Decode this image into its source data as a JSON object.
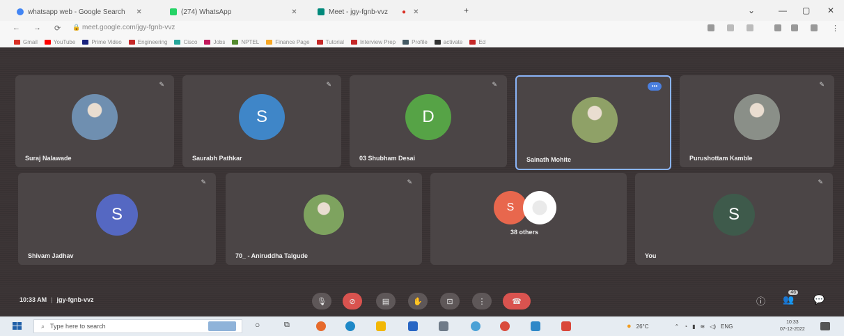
{
  "browser": {
    "tabs": [
      {
        "label": "whatsapp web - Google Search",
        "color": "#4285f4"
      },
      {
        "label": "(274) WhatsApp",
        "color": "#25d366"
      },
      {
        "label": "Meet - jgy-fgnb-vvz",
        "color": "#00897b"
      }
    ],
    "new_tab": "+",
    "url": "meet.google.com/jgy-fgnb-vvz",
    "bookmarks": [
      {
        "label": "Gmail",
        "color": "#d93025"
      },
      {
        "label": "YouTube",
        "color": "#ff0000"
      },
      {
        "label": "Prime Video",
        "color": "#1a237e"
      },
      {
        "label": "Engineering",
        "color": "#c62828"
      },
      {
        "label": "Cisco",
        "color": "#26a69a"
      },
      {
        "label": "Jobs",
        "color": "#c2185b"
      },
      {
        "label": "NPTEL",
        "color": "#558b2f"
      },
      {
        "label": "Finance Page",
        "color": "#f9a825"
      },
      {
        "label": "Tutorial",
        "color": "#c62828"
      },
      {
        "label": "Interview Prep",
        "color": "#c62828"
      },
      {
        "label": "Profile",
        "color": "#455a64"
      },
      {
        "label": "activate",
        "color": "#333333"
      },
      {
        "label": "Ed",
        "color": "#c62828"
      }
    ]
  },
  "meet": {
    "participants": [
      {
        "name": "Suraj Nalawade",
        "kind": "photo",
        "color": "#6f8fb0"
      },
      {
        "name": "Saurabh Pathkar",
        "kind": "letter",
        "letter": "S",
        "color": "#3f86c8"
      },
      {
        "name": "03 Shubham Desai",
        "kind": "letter",
        "letter": "D",
        "color": "#56a346"
      },
      {
        "name": "Sainath Mohite",
        "kind": "photo",
        "color": "#8fa167",
        "active": true,
        "badge": "•••"
      },
      {
        "name": "Purushottam Kamble",
        "kind": "photo",
        "color": "#8a8f88"
      },
      {
        "name": "Shivam Jadhav",
        "kind": "letter",
        "letter": "S",
        "color": "#5568c2"
      },
      {
        "name": "70_ - Aniruddha Talgude",
        "kind": "photo",
        "color": "#7ea35f"
      },
      {
        "name": "",
        "kind": "others"
      },
      {
        "name": "You",
        "kind": "letter",
        "letter": "S",
        "color": "#3e5a4b"
      }
    ],
    "others": {
      "letter": "S",
      "color": "#e8674d",
      "label": "38 others"
    },
    "time": "10:33 AM",
    "meeting_code": "jgy-fgnb-vvz",
    "people_count": "46"
  },
  "taskbar": {
    "search_placeholder": "Type here to search",
    "weather": "26°C",
    "lang": "ENG",
    "time": "10:33",
    "date": "07-12-2022"
  }
}
